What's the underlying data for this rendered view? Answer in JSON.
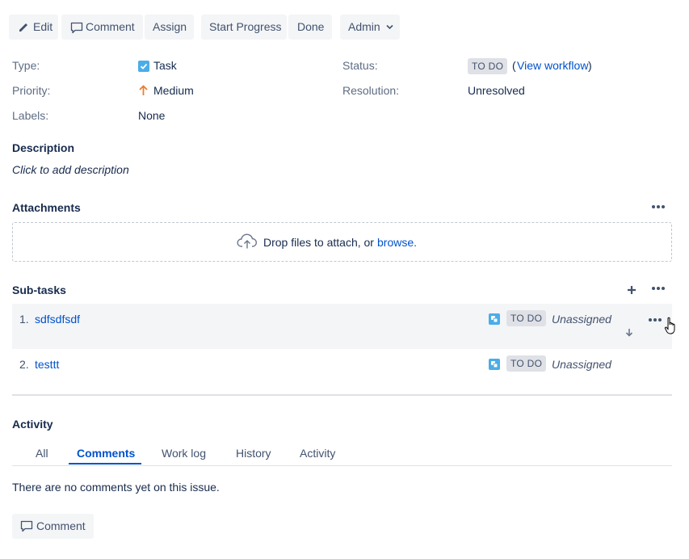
{
  "toolbar": {
    "edit": "Edit",
    "comment": "Comment",
    "assign": "Assign",
    "start_progress": "Start Progress",
    "done": "Done",
    "admin": "Admin"
  },
  "details": {
    "type_label": "Type:",
    "type_value": "Task",
    "priority_label": "Priority:",
    "priority_value": "Medium",
    "labels_label": "Labels:",
    "labels_value": "None",
    "status_label": "Status:",
    "status_value": "TO DO",
    "view_workflow_open": "(",
    "view_workflow": "View workflow",
    "view_workflow_close": ")",
    "resolution_label": "Resolution:",
    "resolution_value": "Unresolved"
  },
  "description": {
    "title": "Description",
    "placeholder": "Click to add description"
  },
  "attachments": {
    "title": "Attachments",
    "drop_text": "Drop files to attach, or ",
    "browse": "browse."
  },
  "subtasks": {
    "title": "Sub-tasks",
    "items": [
      {
        "num": "1.",
        "name": "sdfsdfsdf",
        "status": "TO DO",
        "assignee": "Unassigned"
      },
      {
        "num": "2.",
        "name": "testtt",
        "status": "TO DO",
        "assignee": "Unassigned"
      }
    ]
  },
  "activity": {
    "title": "Activity",
    "tabs": [
      "All",
      "Comments",
      "Work log",
      "History",
      "Activity"
    ],
    "active_tab": "Comments",
    "empty_message": "There are no comments yet on this issue.",
    "comment_button": "Comment"
  },
  "colors": {
    "link": "#0052cc",
    "lozenge_bg": "#dfe1e6",
    "task_icon": "#4bade8",
    "priority_medium": "#e97f33"
  }
}
